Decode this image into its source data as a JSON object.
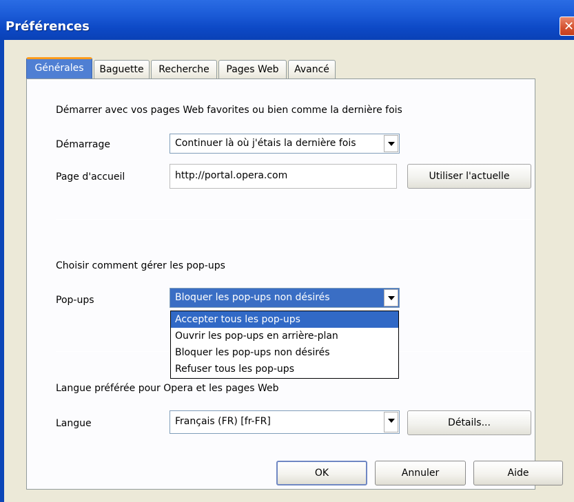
{
  "window": {
    "title": "Préférences"
  },
  "tabs": [
    {
      "label": "Générales",
      "active": true
    },
    {
      "label": "Baguette",
      "active": false
    },
    {
      "label": "Recherche",
      "active": false
    },
    {
      "label": "Pages Web",
      "active": false
    },
    {
      "label": "Avancé",
      "active": false
    }
  ],
  "startup": {
    "section_text": "Démarrer avec vos pages Web favorites ou bien comme la dernière fois",
    "demarrage_label": "Démarrage",
    "demarrage_value": "Continuer là où j'étais la dernière fois",
    "home_label": "Page d'accueil",
    "home_value": "http://portal.opera.com",
    "use_current_button": "Utiliser l'actuelle"
  },
  "popups": {
    "section_text": "Choisir comment gérer les pop-ups",
    "label": "Pop-ups",
    "selected_value": "Bloquer les pop-ups non désirés",
    "options": [
      "Accepter tous les pop-ups",
      "Ouvrir les pop-ups en arrière-plan",
      "Bloquer les pop-ups non désirés",
      "Refuser tous les pop-ups"
    ],
    "highlighted_option": "Accepter tous les pop-ups"
  },
  "language": {
    "section_text": "Langue préférée pour Opera et les pages Web",
    "label": "Langue",
    "value": "Français (FR) [fr-FR]",
    "details_button": "Détails..."
  },
  "footer": {
    "ok_label": "OK",
    "cancel_label": "Annuler",
    "help_label": "Aide"
  },
  "colors": {
    "titlebar": "#0a41b6",
    "active_tab": "#4f7fd3",
    "selection": "#3169c6",
    "client_bg": "#ece9d8"
  }
}
